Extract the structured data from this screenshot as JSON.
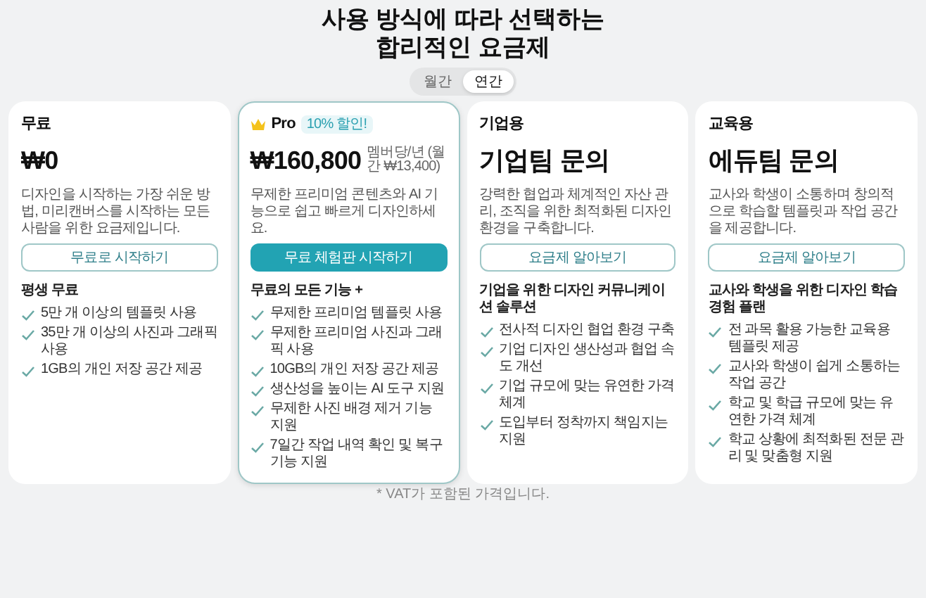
{
  "headline": [
    "사용 방식에 따라 선택하는",
    "합리적인 요금제"
  ],
  "billing_options": [
    {
      "label": "월간",
      "selected": false
    },
    {
      "label": "연간",
      "selected": true
    }
  ],
  "plans": [
    {
      "name": "무료",
      "featured": false,
      "price": "₩0",
      "description": "디자인을 시작하는 가장 쉬운 방법, 미리캔버스를 시작하는 모든 사람을 위한 요금제입니다.",
      "button": "무료로 시작하기",
      "features_heading": "평생 무료",
      "features": [
        "5만 개 이상의 템플릿 사용",
        "35만 개 이상의 사진과 그래픽 사용",
        "1GB의 개인 저장 공간 제공"
      ]
    },
    {
      "name": "Pro",
      "featured": true,
      "badge": "10% 할인!",
      "price": "₩160,800",
      "price_note": "멤버당/년 (월간 ₩13,400)",
      "description": "무제한 프리미엄 콘텐츠와 AI 기능으로 쉽고 빠르게 디자인하세요.",
      "button": "무료 체험판 시작하기",
      "features_heading": "무료의 모든 기능 +",
      "features": [
        "무제한 프리미엄 템플릿 사용",
        "무제한 프리미엄 사진과 그래픽 사용",
        "10GB의 개인 저장 공간 제공",
        "생산성을 높이는 AI 도구 지원",
        "무제한 사진 배경 제거 기능 지원",
        "7일간 작업 내역 확인 및 복구 기능 지원"
      ]
    },
    {
      "name": "기업용",
      "featured": false,
      "price": "기업팀 문의",
      "description": "강력한 협업과 체계적인 자산 관리, 조직을 위한 최적화된 디자인 환경을 구축합니다.",
      "button": "요금제 알아보기",
      "features_heading": "기업을 위한 디자인 커뮤니케이션 솔루션",
      "features": [
        "전사적 디자인 협업 환경 구축",
        "기업 디자인 생산성과 협업 속도 개선",
        "기업 규모에 맞는 유연한 가격 체계",
        "도입부터 정착까지 책임지는 지원"
      ]
    },
    {
      "name": "교육용",
      "featured": false,
      "price": "에듀팀 문의",
      "description": "교사와 학생이 소통하며 창의적으로 학습할 템플릿과 작업 공간을 제공합니다.",
      "button": "요금제 알아보기",
      "features_heading": "교사와 학생을 위한 디자인 학습 경험 플랜",
      "features": [
        "전 과목 활용 가능한 교육용 템플릿 제공",
        "교사와 학생이 쉽게 소통하는 작업 공간",
        "학교 및 학급 규모에 맞는 유연한 가격 체계",
        "학교 상황에 최적화된 전문 관리 및 맞춤형 지원"
      ]
    }
  ],
  "footnote": "* VAT가 포함된 가격입니다."
}
